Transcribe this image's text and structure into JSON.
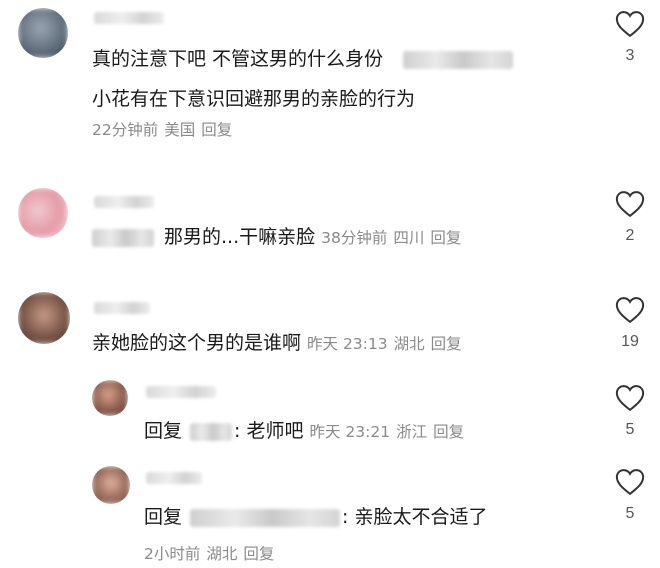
{
  "comments": [
    {
      "text_a": "真的注意下吧  不管这男的什么身份",
      "text_b": "小花有在下意识回避那男的亲脸的行为",
      "time": "22分钟前",
      "location": "美国",
      "reply": "回复",
      "likes": "3"
    },
    {
      "text": "那男的...干嘛亲脸",
      "time": "38分钟前",
      "location": "四川",
      "reply": "回复",
      "likes": "2"
    },
    {
      "text": "亲她脸的这个男的是谁啊",
      "time": "昨天 23:13",
      "location": "湖北",
      "reply": "回复",
      "likes": "19",
      "replies": [
        {
          "prefix": "回复",
          "text": ": 老师吧",
          "time": "昨天 23:21",
          "location": "浙江",
          "reply": "回复",
          "likes": "5"
        },
        {
          "prefix": "回复",
          "text": ": 亲脸太不合适了",
          "time": "2小时前",
          "location": "湖北",
          "reply": "回复",
          "likes": "5"
        }
      ]
    }
  ],
  "icons": {
    "like": "heart-outline-icon"
  }
}
